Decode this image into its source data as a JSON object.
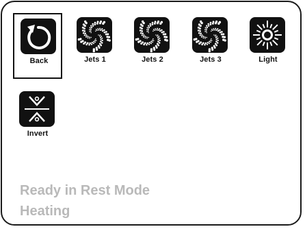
{
  "buttons": [
    {
      "label": "Back",
      "icon": "back-arrow-icon"
    },
    {
      "label": "Jets 1",
      "icon": "jets-icon"
    },
    {
      "label": "Jets 2",
      "icon": "jets-icon"
    },
    {
      "label": "Jets 3",
      "icon": "jets-icon"
    },
    {
      "label": "Light",
      "icon": "sun-icon"
    },
    {
      "label": "Invert",
      "icon": "invert-icon"
    }
  ],
  "status": {
    "line1": "Ready in Rest Mode",
    "line2": "Heating"
  },
  "colors": {
    "tile": "#111111",
    "status_text": "#b9b9b9",
    "border": "#1a1a1a"
  }
}
